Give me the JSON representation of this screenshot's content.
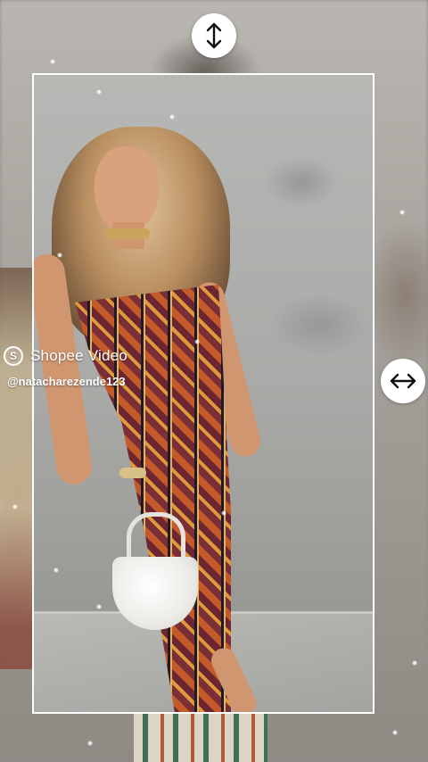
{
  "watermark": {
    "brand_logo_letter": "S",
    "brand_name": "Shopee Video",
    "creator_handle": "@natacharezende123"
  },
  "handles": {
    "vertical_icon": "vertical-resize-arrows-icon",
    "horizontal_icon": "horizontal-resize-arrows-icon"
  },
  "colors": {
    "frame_border": "#ffffff",
    "handle_bg": "#ffffff",
    "dress_primary": "#c45a2a",
    "dress_secondary": "#7a2f36",
    "wall": "#a9aaa7"
  }
}
